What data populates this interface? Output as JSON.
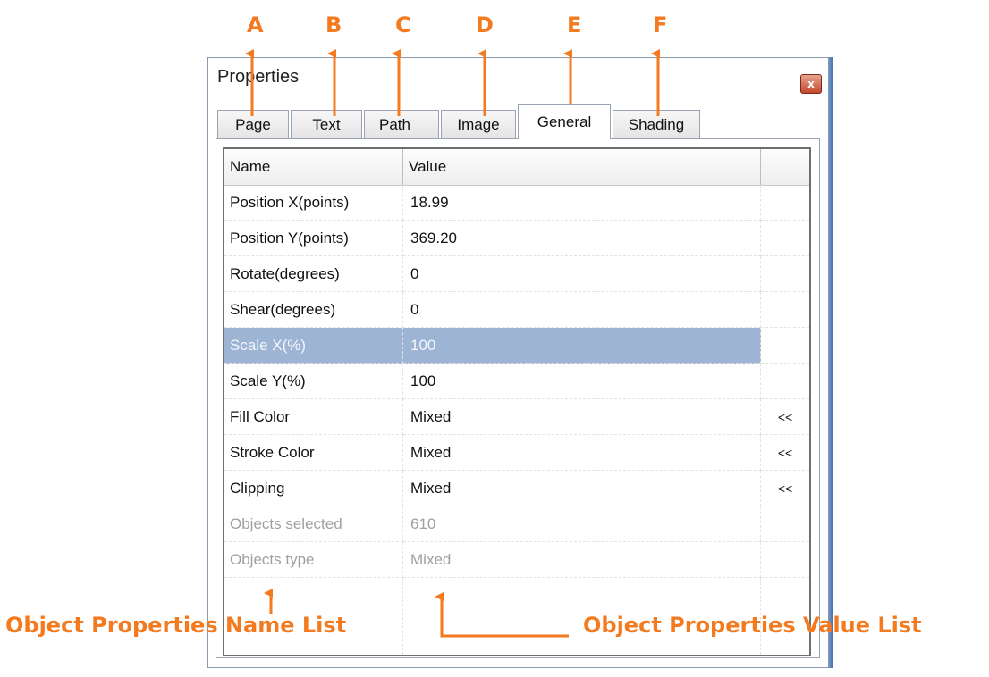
{
  "window": {
    "title": "Properties",
    "close_glyph": "x",
    "accent_color": "#f47a1f"
  },
  "tabs": [
    {
      "label": "Page"
    },
    {
      "label": "Text"
    },
    {
      "label": "Path"
    },
    {
      "label": "Image"
    },
    {
      "label": "General",
      "active": true
    },
    {
      "label": "Shading"
    }
  ],
  "grid": {
    "columns": [
      "Name",
      "Value",
      ""
    ],
    "rows": [
      {
        "name": "Position X(points)",
        "value": "18.99",
        "extra": ""
      },
      {
        "name": "Position Y(points)",
        "value": "369.20",
        "extra": ""
      },
      {
        "name": "Rotate(degrees)",
        "value": "0",
        "extra": ""
      },
      {
        "name": "Shear(degrees)",
        "value": "0",
        "extra": ""
      },
      {
        "name": "Scale X(%)",
        "value": "100",
        "extra": "",
        "selected": true
      },
      {
        "name": "Scale Y(%)",
        "value": "100",
        "extra": ""
      },
      {
        "name": "Fill Color",
        "value": "Mixed",
        "extra": "<<"
      },
      {
        "name": "Stroke Color",
        "value": "Mixed",
        "extra": "<<"
      },
      {
        "name": "Clipping",
        "value": "Mixed",
        "extra": "<<"
      },
      {
        "name": "Objects selected",
        "value": "610",
        "extra": "",
        "disabled": true
      },
      {
        "name": "Objects type",
        "value": "Mixed",
        "extra": "",
        "disabled": true
      }
    ]
  },
  "annotations": {
    "letters": [
      "A",
      "B",
      "C",
      "D",
      "E",
      "F"
    ],
    "name_list_label": "Object Properties Name List",
    "value_list_label": "Object Properties Value List"
  }
}
